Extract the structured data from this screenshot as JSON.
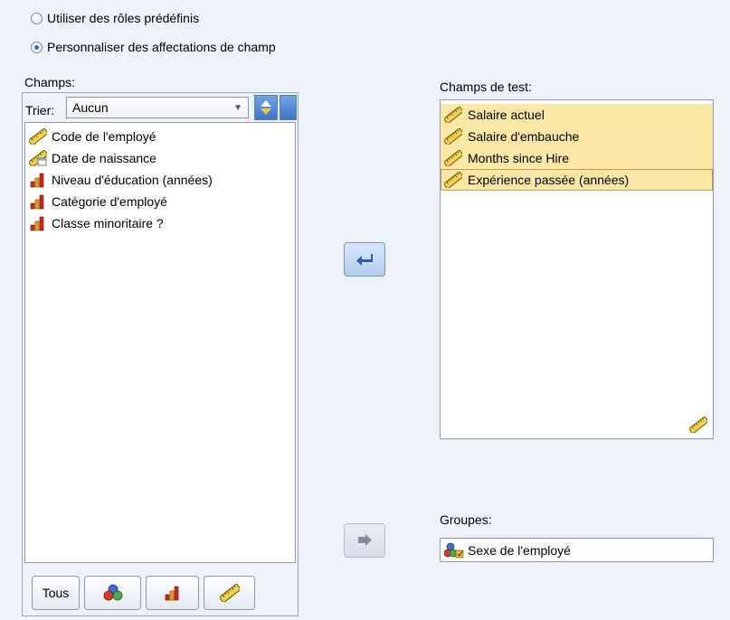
{
  "role_options": {
    "predefined": {
      "label": "Utiliser des rôles prédéfinis",
      "checked": false
    },
    "custom": {
      "label": "Personnaliser des affectations de champ",
      "checked": true
    }
  },
  "fields_panel": {
    "title": "Champs:",
    "sort_label": "Trier:",
    "sort_value": "Aucun",
    "items": [
      {
        "label": "Code de l'employé",
        "icon": "ruler-icon"
      },
      {
        "label": "Date de naissance",
        "icon": "date-ruler-icon"
      },
      {
        "label": "Niveau d'éducation (années)",
        "icon": "ordinal-bar-icon"
      },
      {
        "label": "Catégorie d'employé",
        "icon": "ordinal-bar-icon"
      },
      {
        "label": "Classe minoritaire ?",
        "icon": "ordinal-bar-icon"
      }
    ],
    "filter_buttons": {
      "all_label": "Tous",
      "nominal_icon": "nominal-circles-icon",
      "ordinal_icon": "ordinal-bar-icon",
      "scale_icon": "ruler-icon"
    }
  },
  "test_fields": {
    "title": "Champs de test:",
    "items": [
      {
        "label": "Salaire actuel",
        "icon": "ruler-icon"
      },
      {
        "label": "Salaire d'embauche",
        "icon": "ruler-icon"
      },
      {
        "label": "Months since Hire",
        "icon": "ruler-icon"
      },
      {
        "label": "Expérience passée (années)",
        "icon": "ruler-icon"
      }
    ],
    "footer_icon": "ruler-icon"
  },
  "groups": {
    "title": "Groupes:",
    "value": "Sexe de l'employé",
    "icon": "nominal-person-icon"
  },
  "colors": {
    "background": "#eef3fa",
    "selection_highlight": "#fbe7a6",
    "radio_accent": "#2a6fd1"
  }
}
